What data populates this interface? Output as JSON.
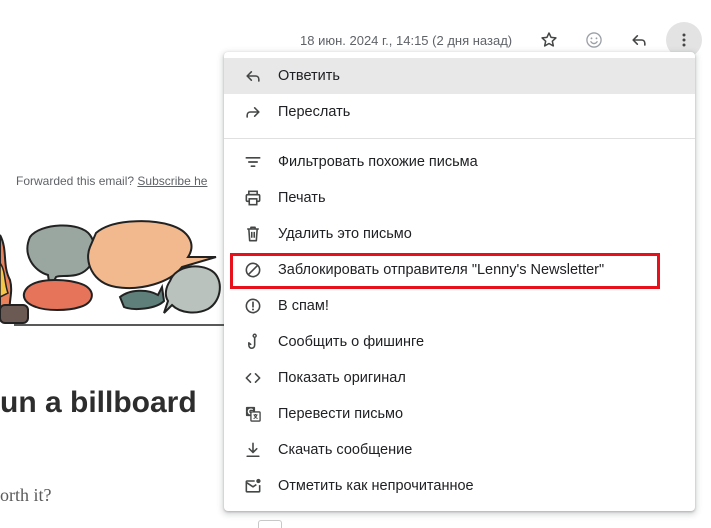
{
  "header": {
    "date_text": "18 июн. 2024 г., 14:15 (2 дня назад)",
    "star_icon": "star-icon",
    "emoji_icon": "emoji-icon",
    "reply_icon": "reply-icon",
    "more_icon": "more-vert-icon"
  },
  "email": {
    "forwarded_prefix": "Forwarded this email? ",
    "forwarded_link": "Subscribe he",
    "headline": "un a billboard",
    "subline": "orth it?"
  },
  "menu": {
    "items": [
      {
        "label": "Ответить",
        "icon": "reply-icon"
      },
      {
        "label": "Переслать",
        "icon": "forward-icon"
      },
      {
        "label": "Фильтровать похожие письма",
        "icon": "filter-icon"
      },
      {
        "label": "Печать",
        "icon": "print-icon"
      },
      {
        "label": "Удалить это письмо",
        "icon": "trash-icon"
      },
      {
        "label": "Заблокировать отправителя \"Lenny's Newsletter\"",
        "icon": "block-icon"
      },
      {
        "label": "В спам!",
        "icon": "report-spam-icon"
      },
      {
        "label": "Сообщить о фишинге",
        "icon": "phishing-hook-icon"
      },
      {
        "label": "Показать оригинал",
        "icon": "code-icon"
      },
      {
        "label": "Перевести письмо",
        "icon": "translate-icon"
      },
      {
        "label": "Скачать сообщение",
        "icon": "download-icon"
      },
      {
        "label": "Отметить как непрочитанное",
        "icon": "mark-unread-icon"
      }
    ]
  },
  "colors": {
    "highlight": "#e8101a",
    "hover": "#e8e8e8",
    "icon": "#444746"
  }
}
